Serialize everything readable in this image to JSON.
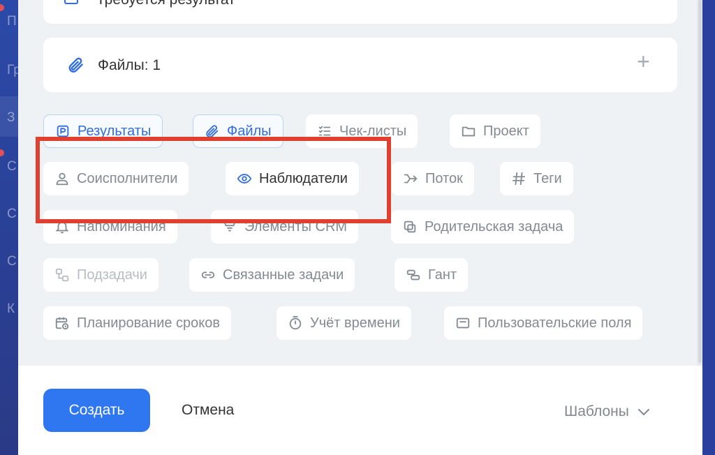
{
  "background": {
    "sidebar_letters": [
      "П",
      "Гр",
      "З",
      "С",
      "С",
      "С",
      "К"
    ]
  },
  "top_card": {
    "partial_text": "Требуется результат"
  },
  "files_card": {
    "title": "Файлы: 1",
    "add_symbol": "+"
  },
  "chips": {
    "results": "Результаты",
    "files": "Файлы",
    "checklists": "Чек-листы",
    "project": "Проект",
    "coexecutors": "Соисполнители",
    "observers": "Наблюдатели",
    "flow": "Поток",
    "tags": "Теги",
    "reminders": "Напоминания",
    "crm": "Элементы CRM",
    "parent_task": "Родительская задача",
    "subtasks": "Подзадачи",
    "linked_tasks": "Связанные задачи",
    "gantt": "Гант",
    "deadline_planning": "Планирование сроков",
    "time_tracking": "Учёт времени",
    "custom_fields": "Пользовательские поля"
  },
  "footer": {
    "create_label": "Создать",
    "cancel_label": "Отмена",
    "templates_label": "Шаблоны"
  },
  "colors": {
    "accent": "#2f77f0",
    "active_chip": "#2f6de1",
    "highlight": "#e0402f"
  }
}
